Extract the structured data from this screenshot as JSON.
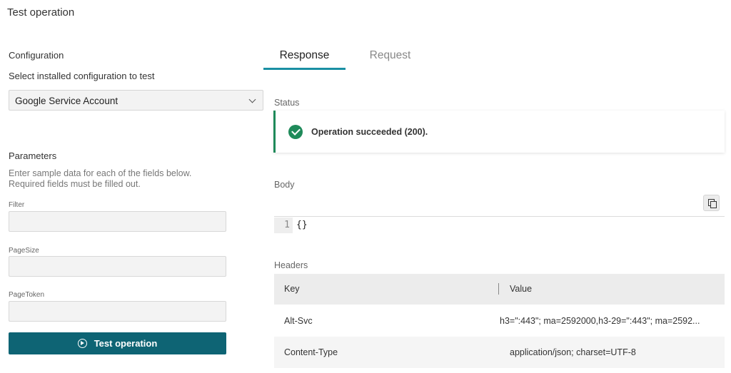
{
  "page": {
    "title": "Test operation"
  },
  "configuration": {
    "heading": "Configuration",
    "select_label": "Select installed configuration to test",
    "selected": "Google Service Account"
  },
  "parameters": {
    "heading": "Parameters",
    "help_line1": "Enter sample data for each of the fields below.",
    "help_line2": "Required fields must be filled out.",
    "fields": [
      {
        "label": "Filter",
        "value": ""
      },
      {
        "label": "PageSize",
        "value": ""
      },
      {
        "label": "PageToken",
        "value": ""
      }
    ],
    "test_button": "Test operation"
  },
  "tabs": [
    {
      "label": "Response",
      "active": true
    },
    {
      "label": "Request",
      "active": false
    }
  ],
  "status": {
    "label": "Status",
    "message": "Operation succeeded (200).",
    "color": "#1f8a5a"
  },
  "body": {
    "label": "Body",
    "line_number": "1",
    "code": "{}"
  },
  "headers": {
    "label": "Headers",
    "columns": [
      "Key",
      "Value"
    ],
    "rows": [
      {
        "key": "Alt-Svc",
        "value": "h3=\":443\"; ma=2592000,h3-29=\":443\"; ma=2592..."
      },
      {
        "key": "Content-Type",
        "value": "application/json; charset=UTF-8"
      }
    ]
  },
  "colors": {
    "accent": "#0e6474",
    "tab_underline": "#1a8fa3"
  }
}
